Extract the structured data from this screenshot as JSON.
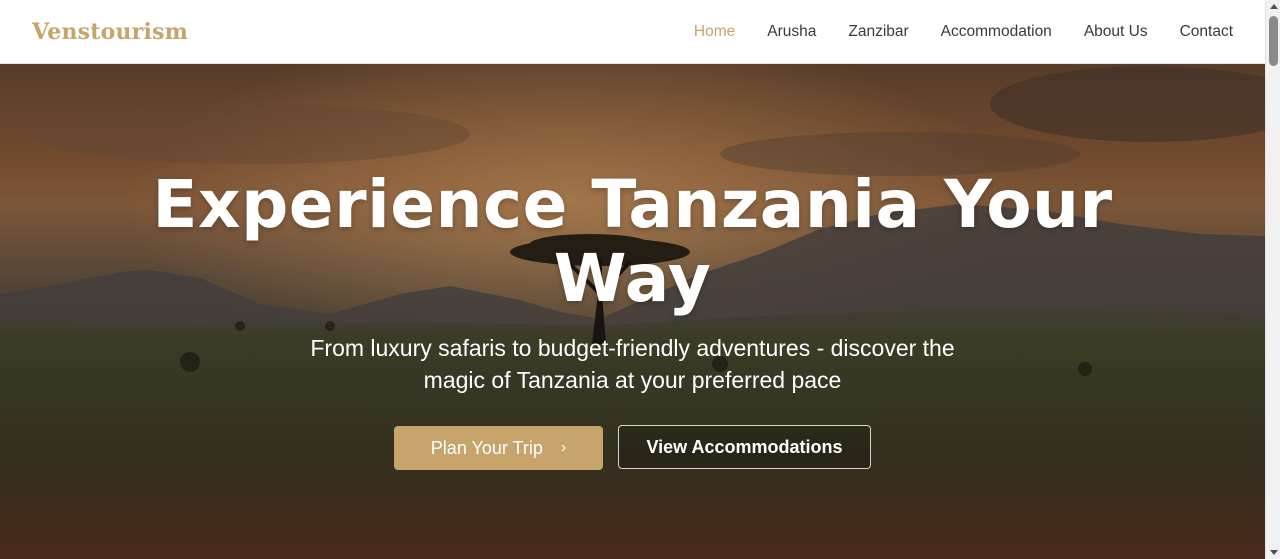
{
  "colors": {
    "brand": "#c6a46c",
    "nav_active": "#c6a46c",
    "nav_text": "#3a3a3a",
    "primary_button": "#c6a46c"
  },
  "header": {
    "brand": "Venstourism",
    "nav": [
      {
        "label": "Home",
        "active": true
      },
      {
        "label": "Arusha",
        "active": false
      },
      {
        "label": "Zanzibar",
        "active": false
      },
      {
        "label": "Accommodation",
        "active": false
      },
      {
        "label": "About Us",
        "active": false
      },
      {
        "label": "Contact",
        "active": false
      }
    ]
  },
  "hero": {
    "title": "Experience Tanzania Your Way",
    "subtitle": "From luxury safaris to budget-friendly adventures - discover the magic of Tanzania at your preferred pace",
    "primary_button": {
      "label": "Plan Your Trip",
      "icon": "chevron-right-icon"
    },
    "secondary_button": {
      "label": "View Accommodations"
    }
  }
}
